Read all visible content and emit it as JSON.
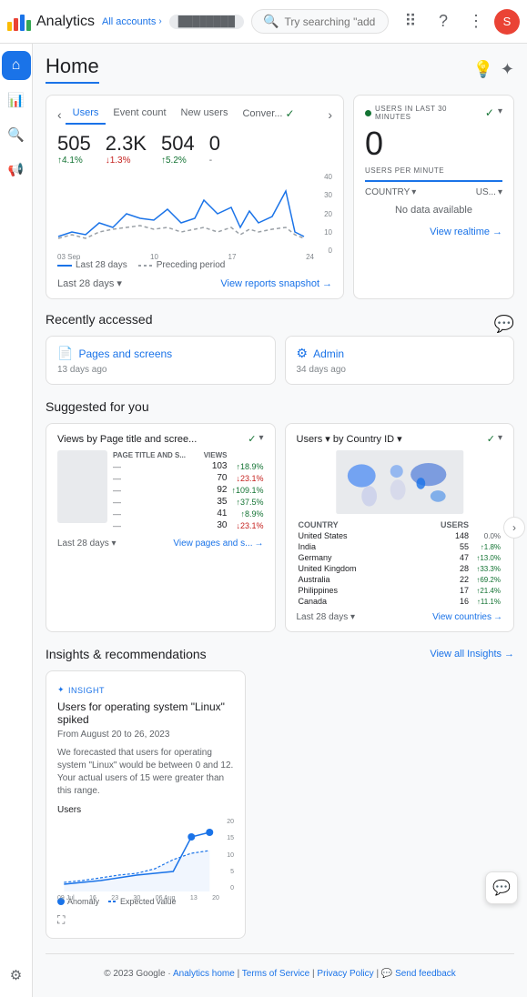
{
  "topbar": {
    "app_name": "Analytics",
    "all_accounts_label": "All accounts",
    "search_placeholder": "Try searching \"add web stream\"",
    "avatar_letter": "S"
  },
  "sidebar": {
    "items": [
      {
        "id": "home",
        "icon": "⌂",
        "label": "Home",
        "active": true
      },
      {
        "id": "reports",
        "icon": "📊",
        "label": "Reports",
        "active": false
      },
      {
        "id": "explore",
        "icon": "🔍",
        "label": "Explore",
        "active": false
      },
      {
        "id": "advertising",
        "icon": "📢",
        "label": "Advertising",
        "active": false
      },
      {
        "id": "configure",
        "icon": "⚙",
        "label": "Configure",
        "active": false
      }
    ]
  },
  "page": {
    "title": "Home"
  },
  "metrics": {
    "tabs": [
      "Users",
      "Event count",
      "New users",
      "Conver..."
    ],
    "active_tab": "Users",
    "values": [
      {
        "label": "Users",
        "value": "505",
        "change": "↑4.1%",
        "dir": "up"
      },
      {
        "label": "Event count",
        "value": "2.3K",
        "change": "↓1.3%",
        "dir": "down"
      },
      {
        "label": "New users",
        "value": "504",
        "change": "↑5.2%",
        "dir": "up"
      },
      {
        "label": "Conver...",
        "value": "0",
        "change": "-",
        "dir": "neutral"
      }
    ],
    "y_labels": [
      "40",
      "30",
      "20",
      "10",
      "0"
    ],
    "x_labels": [
      "03 Sep",
      "10",
      "17",
      "24"
    ],
    "legend_solid": "Last 28 days",
    "legend_dashed": "Preceding period",
    "date_range": "Last 28 days",
    "view_reports": "View reports snapshot"
  },
  "realtime": {
    "title": "USERS IN LAST 30 MINUTES",
    "value": "0",
    "users_per_min": "USERS PER MINUTE",
    "country_label": "COUNTRY",
    "us_label": "US...",
    "no_data": "No data available",
    "view_realtime": "View realtime"
  },
  "recently_accessed": {
    "title": "Recently accessed",
    "items": [
      {
        "icon": "📄",
        "title": "Pages and screens",
        "date": "13 days ago"
      },
      {
        "icon": "⚙",
        "title": "Admin",
        "date": "34 days ago"
      }
    ]
  },
  "suggested": {
    "title": "Suggested for you",
    "cards": [
      {
        "title": "Views by Page title and scree...",
        "subtitle": "PAGE TITLE AND S...",
        "views_header": "VIEWS",
        "rows": [
          {
            "views": "103",
            "change": "↑18.9%",
            "dir": "up"
          },
          {
            "views": "70",
            "change": "↓23.1%",
            "dir": "down"
          },
          {
            "views": "92",
            "change": "↑109.1%",
            "dir": "up"
          },
          {
            "views": "35",
            "change": "↑37.5%",
            "dir": "up"
          },
          {
            "views": "41",
            "change": "↑8.9%",
            "dir": "up"
          },
          {
            "views": "30",
            "change": "↓23.1%",
            "dir": "down"
          }
        ],
        "date_range": "Last 28 days",
        "view_link": "View pages and s..."
      },
      {
        "title": "Users ▾ by Country ID ▾",
        "country_header": "COUNTRY",
        "users_header": "USERS",
        "countries": [
          {
            "name": "United States",
            "users": "148",
            "change": "0.0%",
            "dir": "neutral"
          },
          {
            "name": "India",
            "users": "55",
            "change": "↑1.8%",
            "dir": "up"
          },
          {
            "name": "Germany",
            "users": "47",
            "change": "↑13.0%",
            "dir": "up"
          },
          {
            "name": "United Kingdom",
            "users": "28",
            "change": "↑33.3%",
            "dir": "up"
          },
          {
            "name": "Australia",
            "users": "22",
            "change": "↑69.2%",
            "dir": "up"
          },
          {
            "name": "Philippines",
            "users": "17",
            "change": "↑21.4%",
            "dir": "up"
          },
          {
            "name": "Canada",
            "users": "16",
            "change": "↑11.1%",
            "dir": "up"
          }
        ],
        "date_range": "Last 28 days",
        "view_link": "View countries"
      }
    ]
  },
  "insights": {
    "title": "Insights & recommendations",
    "view_all": "View all Insights",
    "card": {
      "badge": "INSIGHT",
      "title": "Users for operating system \"Linux\" spiked",
      "date": "From August 20 to 26, 2023",
      "text": "We forecasted that users for operating system \"Linux\" would be between 0 and 12. Your actual users of 15 were greater than this range.",
      "chart_label": "Users",
      "x_labels": [
        "09 Jul",
        "16",
        "23",
        "30",
        "06 Aug",
        "13",
        "20"
      ],
      "y_labels": [
        "20",
        "15",
        "10",
        "5",
        "0"
      ],
      "legend_anomaly": "Anomaly",
      "legend_expected": "Expected value"
    }
  },
  "footer": {
    "copyright": "© 2023 Google",
    "links": [
      "Analytics home",
      "Terms of Service",
      "Privacy Policy",
      "Send feedback"
    ]
  }
}
